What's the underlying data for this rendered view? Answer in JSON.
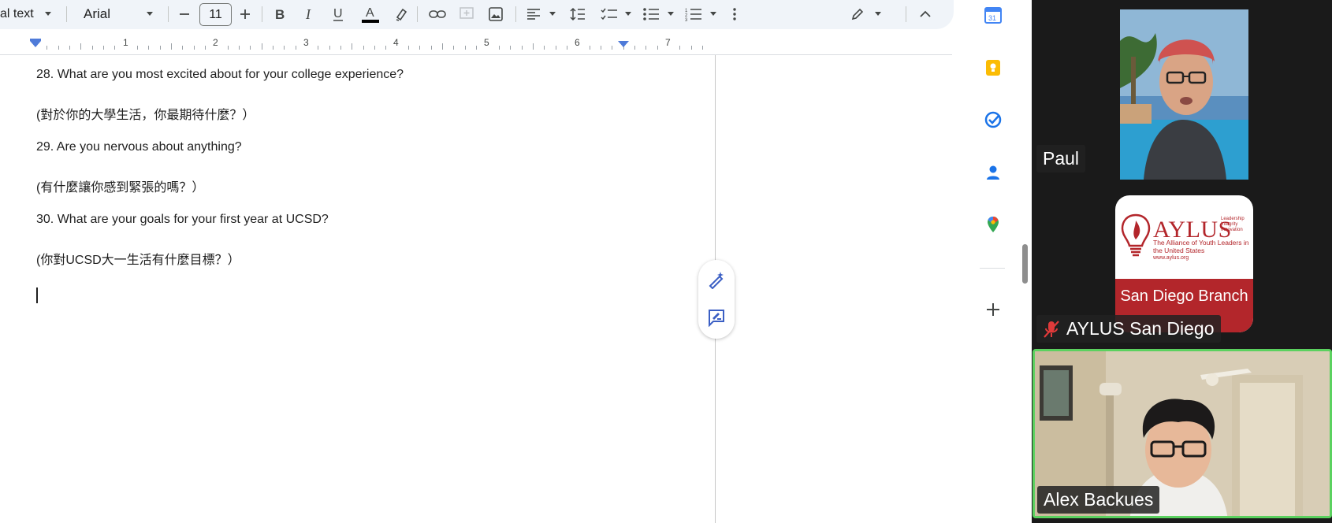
{
  "toolbar": {
    "style_label": "al text",
    "font_label": "Arial",
    "font_size": "11",
    "icons": [
      "minus-icon",
      "plus-icon",
      "bold-icon",
      "italic-icon",
      "underline-icon",
      "text-color-icon",
      "highlight-icon",
      "link-icon",
      "add-comment-icon",
      "insert-image-icon",
      "align-icon",
      "line-spacing-icon",
      "checklist-icon",
      "bullet-list-icon",
      "numbered-list-icon",
      "more-icon",
      "editing-mode-icon",
      "collapse-icon"
    ]
  },
  "ruler": {
    "numbers": [
      "1",
      "2",
      "3",
      "4",
      "5",
      "6",
      "7"
    ]
  },
  "document": {
    "lines": [
      "28. What are you most excited about for your college experience?",
      "(對於你的大學生活，你最期待什麼？）",
      "29. Are you nervous about anything?",
      "(有什麼讓你感到緊張的嗎？）",
      "30. What are your goals for your first year at UCSD?",
      "(你對UCSD大一生活有什麼目標？）"
    ]
  },
  "side_panel": {
    "icons": [
      "calendar-icon",
      "keep-icon",
      "tasks-icon",
      "contacts-icon",
      "maps-icon",
      "add-icon"
    ],
    "calendar_day": "31"
  },
  "participants": {
    "paul": {
      "name": "Paul"
    },
    "aylus": {
      "name": "AYLUS San Diego",
      "muted": true,
      "logo_brand": "AYLUS",
      "logo_tags": [
        "Leadership",
        "Integrity",
        "Innovation"
      ],
      "logo_subtitle": "The Alliance of Youth Leaders in the United States",
      "logo_url": "www.aylus.org",
      "logo_branch": "San Diego Branch"
    },
    "alex": {
      "name": "Alex Backues",
      "active_speaker": true
    }
  },
  "colors": {
    "accent_blue": "#4f7bd9",
    "speaker_green": "#5bd15f",
    "aylus_red": "#b3262b",
    "mute_red": "#e03a3a"
  }
}
